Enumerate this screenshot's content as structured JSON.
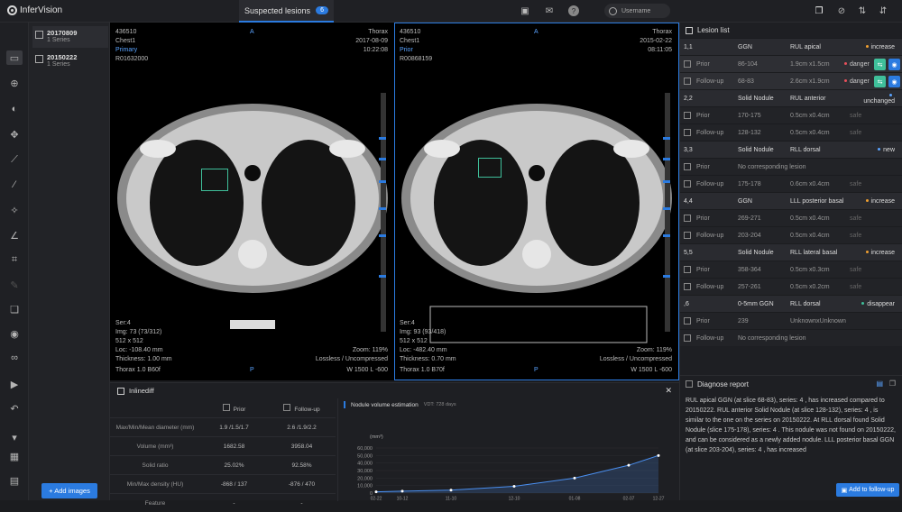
{
  "app": {
    "name": "InferVision"
  },
  "topbar": {
    "tab_label": "Suspected lesions",
    "tab_count": "6",
    "username_placeholder": "Username"
  },
  "series": [
    {
      "date": "20170809",
      "count": "1 Series"
    },
    {
      "date": "20150222",
      "count": "1 Series"
    }
  ],
  "add_images_label": "+ Add images",
  "viewers": [
    {
      "patient_id": "436510",
      "study": "Chest1",
      "role": "Primary",
      "accession": "R01632000",
      "orient_top": "A",
      "orient_bottom": "P",
      "body": "Thorax",
      "date": "2017-08-09",
      "time": "10:22:08",
      "ser": "Ser:4",
      "img": "Img: 73 (73/312)",
      "matrix": "512 x 512",
      "loc": "Loc: -108.40 mm",
      "thickness": "Thickness: 1.00 mm",
      "kernel": "Thorax 1.0 B60f",
      "zoom": "Zoom: 119%",
      "compression": "Lossless / Uncompressed",
      "window": "W 1500 L -600"
    },
    {
      "patient_id": "436510",
      "study": "Chest1",
      "role": "Prior",
      "accession": "R00868159",
      "orient_top": "A",
      "orient_bottom": "P",
      "body": "Thorax",
      "date": "2015-02-22",
      "time": "08:11:05",
      "ser": "Ser:4",
      "img": "Img: 93 (93/418)",
      "matrix": "512 x 512",
      "loc": "Loc: -482.40 mm",
      "thickness": "Thickness: 0.70 mm",
      "kernel": "Thorax 1.0 B70f",
      "zoom": "Zoom: 119%",
      "compression": "Lossless / Uncompressed",
      "window": "W 1500 L -600"
    }
  ],
  "lesion_list": {
    "title": "Lesion list",
    "groups": [
      {
        "id": "1,1",
        "type": "GGN",
        "loc": "RUL apical",
        "status": "increase",
        "status_color": "#f0a030",
        "rows": [
          {
            "label": "Prior",
            "slices": "86-104",
            "size": "1.9cm x1.5cm",
            "risk": "danger",
            "risk_color": "#e8505b"
          },
          {
            "label": "Follow-up",
            "slices": "68-83",
            "size": "2.6cm x1.9cm",
            "risk": "danger",
            "risk_color": "#e8505b"
          }
        ]
      },
      {
        "id": "2,2",
        "type": "Solid Nodule",
        "loc": "RUL anterior",
        "status": "unchanged",
        "status_color": "#5aa3ff",
        "rows": [
          {
            "label": "Prior",
            "slices": "170-175",
            "size": "0.5cm x0.4cm",
            "risk": "safe",
            "risk_color": ""
          },
          {
            "label": "Follow-up",
            "slices": "128-132",
            "size": "0.5cm x0.4cm",
            "risk": "safe",
            "risk_color": ""
          }
        ]
      },
      {
        "id": "3,3",
        "type": "Solid Nodule",
        "loc": "RLL dorsal",
        "status": "new",
        "status_color": "#5aa3ff",
        "rows": [
          {
            "label": "Prior",
            "slices": "No corresponding lesion",
            "size": "",
            "risk": "",
            "risk_color": ""
          },
          {
            "label": "Follow-up",
            "slices": "175-178",
            "size": "0.6cm x0.4cm",
            "risk": "safe",
            "risk_color": ""
          }
        ]
      },
      {
        "id": "4,4",
        "type": "GGN",
        "loc": "LLL posterior basal",
        "status": "increase",
        "status_color": "#f0a030",
        "rows": [
          {
            "label": "Prior",
            "slices": "269-271",
            "size": "0.5cm x0.4cm",
            "risk": "safe",
            "risk_color": ""
          },
          {
            "label": "Follow-up",
            "slices": "203-204",
            "size": "0.5cm x0.4cm",
            "risk": "safe",
            "risk_color": ""
          }
        ]
      },
      {
        "id": "5,5",
        "type": "Solid Nodule",
        "loc": "RLL lateral basal",
        "status": "increase",
        "status_color": "#f0a030",
        "rows": [
          {
            "label": "Prior",
            "slices": "358-364",
            "size": "0.5cm x0.3cm",
            "risk": "safe",
            "risk_color": ""
          },
          {
            "label": "Follow-up",
            "slices": "257-261",
            "size": "0.5cm x0.2cm",
            "risk": "safe",
            "risk_color": ""
          }
        ]
      },
      {
        "id": ",6",
        "type": "0-5mm GGN",
        "loc": "RLL dorsal",
        "status": "disappear",
        "status_color": "#3fbf9a",
        "rows": [
          {
            "label": "Prior",
            "slices": "239",
            "size": "UnknownxUnknown",
            "risk": "",
            "risk_color": ""
          },
          {
            "label": "Follow-up",
            "slices": "No corresponding lesion",
            "size": "",
            "risk": "",
            "risk_color": ""
          }
        ]
      }
    ]
  },
  "diagnose": {
    "title": "Diagnose report",
    "text": "RUL apical GGN (at slice 68-83), series: 4 , has increased compared to 20150222. RUL anterior Solid Nodule (at slice 128-132), series: 4 , is similar to the one on the series on 20150222. At RLL dorsal found Solid Nodule (slice 175-178), series: 4 . This nodule was not found on 20150222, and can be considered as a newly added nodule. LLL posterior basal GGN (at slice 203-204), series: 4 , has increased",
    "follow_label": "Add to follow-up"
  },
  "inlinediff": {
    "title": "Inlinediff",
    "col_prior": "Prior",
    "col_follow": "Follow-up",
    "rows": [
      {
        "label": "Max/Min/Mean diameter (mm)",
        "prior": "1.9 /1.5/1.7",
        "follow": "2.6 /1.9/2.2"
      },
      {
        "label": "Volume (mm³)",
        "prior": "1682.58",
        "follow": "3958.04"
      },
      {
        "label": "Solid ratio",
        "prior": "25.02%",
        "follow": "92.58%"
      },
      {
        "label": "Min/Max density (HU)",
        "prior": "-868 / 137",
        "follow": "-876 / 470"
      },
      {
        "label": "Feature",
        "prior": "-",
        "follow": "-"
      }
    ]
  },
  "chart_data": {
    "type": "area",
    "title": "Nodule volume estimation",
    "subtitle": "VDT: 728 days",
    "ylabel": "(mm³)",
    "ylim": [
      0,
      60000
    ],
    "yticks": [
      "60,000",
      "50,000",
      "40,000",
      "30,000",
      "20,000",
      "10,000",
      "0"
    ],
    "x": [
      "02-22 2015",
      "10-12 2015",
      "11-10 2017",
      "12-10 2019",
      "01-08 2022",
      "02-07 2024",
      "12-27 2024"
    ],
    "values": [
      1682,
      2600,
      3958,
      9000,
      20000,
      37000,
      50000
    ],
    "color": "#4a8ff0"
  }
}
